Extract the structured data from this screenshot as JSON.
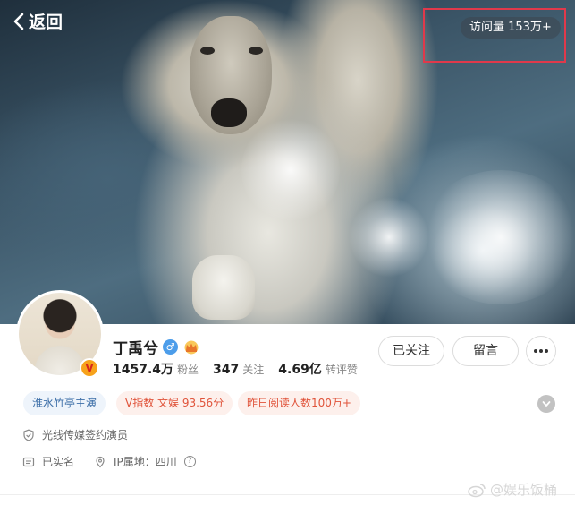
{
  "header": {
    "back_label": "返回",
    "visits_text": "访问量 153万+"
  },
  "profile": {
    "name": "丁禹兮",
    "verified_badge": "V",
    "gender_icon": "♂",
    "stats": [
      {
        "value": "1457.4万",
        "label": "粉丝"
      },
      {
        "value": "347",
        "label": "关注"
      },
      {
        "value": "4.69亿",
        "label": "转评赞"
      }
    ],
    "actions": {
      "follow_label": "已关注",
      "message_label": "留言"
    },
    "tags": [
      {
        "text": "淮水竹亭主演"
      },
      {
        "text": "V指数 文娱 93.56分"
      },
      {
        "text": "昨日阅读人数100万+"
      }
    ],
    "info": {
      "company": "光线传媒签约演员",
      "realname": "已实名",
      "ip_location": "IP属地：四川"
    }
  },
  "watermark": "@娱乐饭桶",
  "colors": {
    "highlight_border": "#e0394b",
    "tag_blue_text": "#3d6fa8",
    "tag_red_text": "#e0533a",
    "verified_orange": "#f7a21b"
  }
}
